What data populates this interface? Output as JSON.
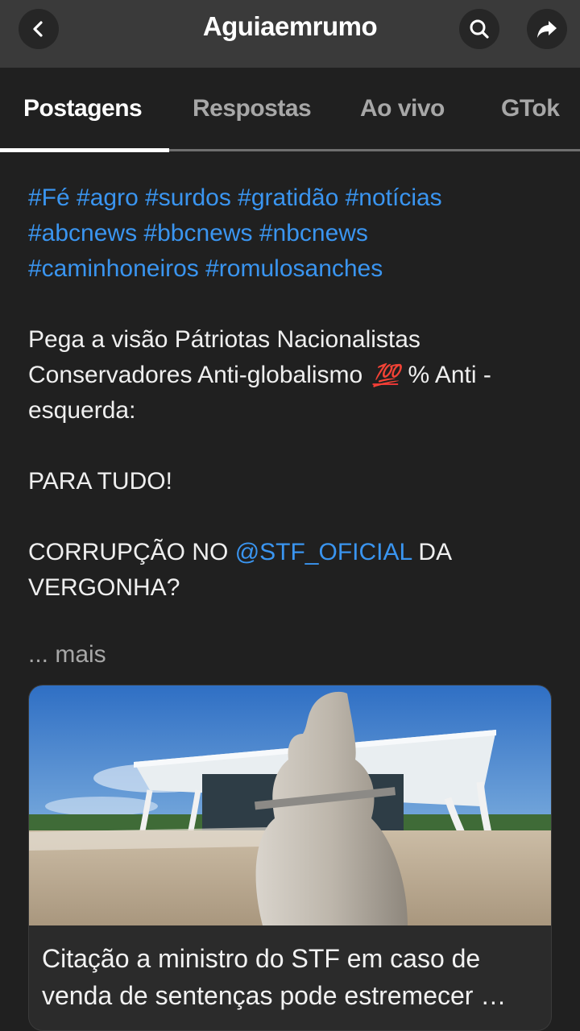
{
  "header": {
    "title": "Aguiaemrumo",
    "back_icon": "back-arrow-icon",
    "search_icon": "search-icon",
    "share_icon": "share-icon"
  },
  "tabs": [
    {
      "label": "Postagens",
      "active": true
    },
    {
      "label": "Respostas",
      "active": false
    },
    {
      "label": "Ao vivo",
      "active": false
    },
    {
      "label": "GTok",
      "active": false
    }
  ],
  "post": {
    "hashtags": [
      "#Fé #agro #surdos #gratidão #notícias",
      "#abcnews #bbcnews #nbcnews",
      "#caminhoneiros #romulosanches"
    ],
    "para1_before": "Pega a visão Pátriotas Nacionalistas Conservadores Anti-globalismo ",
    "emoji": "💯",
    "para1_after": " % Anti - esquerda:",
    "para2": "PARA TUDO!",
    "para3_before": "CORRUPÇÃO NO ",
    "mention": "@STF_OFICIAL",
    "para3_after": " DA VERGONHA?",
    "more": "... mais"
  },
  "card": {
    "title": "Citação a ministro do STF em caso de venda de sentenças pode estremecer …"
  },
  "colors": {
    "background": "#202020",
    "topbar": "#3a3a3a",
    "link": "#3a95f0",
    "emoji": "#e83535"
  }
}
